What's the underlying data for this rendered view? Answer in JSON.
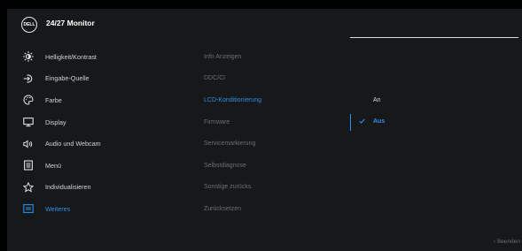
{
  "header": {
    "logo": "DELL",
    "title": "24/27 Monitor"
  },
  "menu": {
    "items": [
      {
        "label": "Helligkeit/Kontrast",
        "icon": "brightness-icon"
      },
      {
        "label": "Eingabe-Quelle",
        "icon": "input-source-icon"
      },
      {
        "label": "Farbe",
        "icon": "color-icon"
      },
      {
        "label": "Display",
        "icon": "display-icon"
      },
      {
        "label": "Audio und Webcam",
        "icon": "audio-icon"
      },
      {
        "label": "Menü",
        "icon": "menu-icon"
      },
      {
        "label": "Individualisieren",
        "icon": "star-icon"
      },
      {
        "label": "Weiteres",
        "icon": "others-icon"
      }
    ],
    "active_index": 7
  },
  "submenu": {
    "items": [
      "Info Anzeigen",
      "DDC/CI",
      "LCD-Konditionierung",
      "Firmware",
      "Servicemarkierung",
      "Selbstdiagnose",
      "Sonstige zurücks.",
      "Zurücksetzen"
    ],
    "selected_index": 2
  },
  "options": {
    "items": [
      "An",
      "Aus"
    ],
    "chosen_index": 1
  },
  "footer": {
    "back_label": "Beenden",
    "back_icon": "chevron-left-icon"
  },
  "colors": {
    "accent": "#2f8ee8",
    "panel": "#17181a",
    "text": "#d2d2d2",
    "muted": "#6e6e70"
  }
}
